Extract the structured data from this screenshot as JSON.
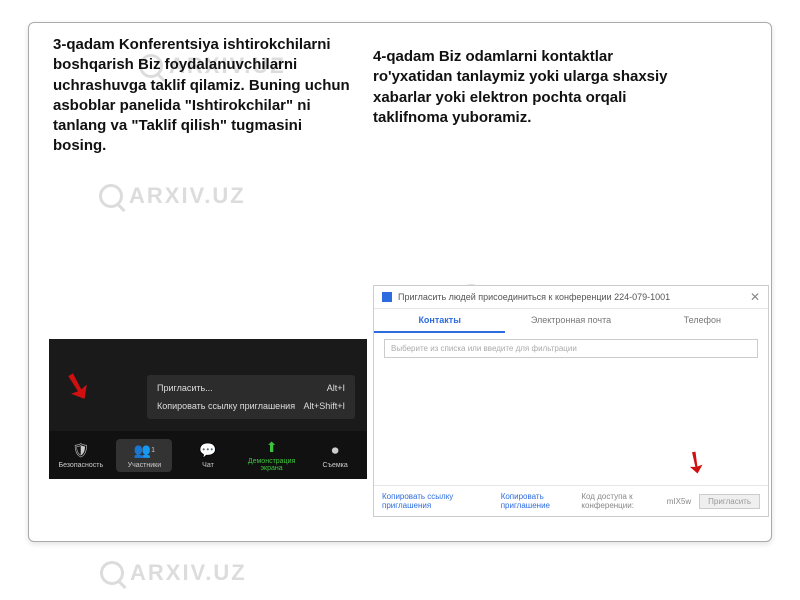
{
  "watermark_text": "ARXIV.UZ",
  "step3_text": "3-qadam Konferentsiya ishtirokchilarni boshqarish Biz foydalanuvchilarni uchrashuvga taklif qilamiz. Buning uchun asboblar panelida \"Ishtirokchilar\" ni tanlang va \"Taklif qilish\" tugmasini bosing.",
  "step4_text": "4-qadam Biz odamlarni kontaktlar ro'yxatidan tanlaymiz yoki ularga shaxsiy xabarlar yoki elektron pochta orqali taklifnoma yuboramiz.",
  "zoom": {
    "popup": [
      {
        "label": "Пригласить...",
        "shortcut": "Alt+I"
      },
      {
        "label": "Копировать ссылку приглашения",
        "shortcut": "Alt+Shift+I"
      }
    ],
    "toolbar": {
      "security": "Безопасность",
      "participants": "Участники",
      "participants_count": "1",
      "chat": "Чат",
      "share": "Демонстрация экрана",
      "record": "Съемка"
    }
  },
  "invite": {
    "title": "Пригласить людей присоединиться к конференции 224-079-1001",
    "tabs": {
      "contacts": "Контакты",
      "email": "Электронная почта",
      "phone": "Телефон"
    },
    "search_placeholder": "Выберите из списка или введите для фильтрации",
    "footer": {
      "copy_link": "Копировать ссылку приглашения",
      "copy_invite": "Копировать приглашение",
      "conf_code_label": "Код доступа к конференции:",
      "conf_code": "mIX5w",
      "invite_btn": "Пригласить"
    }
  }
}
